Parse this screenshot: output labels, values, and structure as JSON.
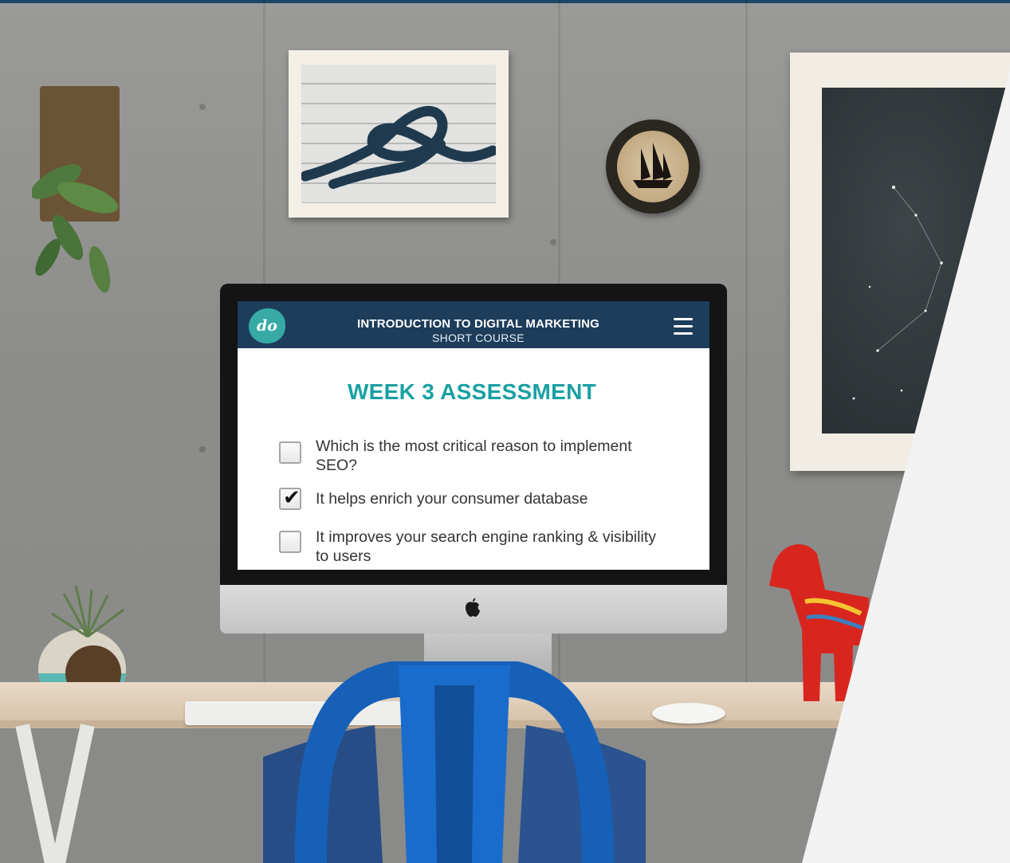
{
  "app": {
    "logo_text": "do",
    "title": "INTRODUCTION TO DIGITAL MARKETING",
    "subtitle": "SHORT COURSE",
    "menu_icon": "hamburger-menu-icon"
  },
  "assessment": {
    "heading": "WEEK 3 ASSESSMENT",
    "items": [
      {
        "text": "Which is the most critical reason to implement SEO?",
        "checked": false
      },
      {
        "text": "It helps enrich your consumer database",
        "checked": true
      },
      {
        "text": "It improves your search engine ranking & visibility to users",
        "checked": false
      }
    ]
  },
  "colors": {
    "header_bg": "#1d3d5b",
    "accent_teal": "#1aa0a3",
    "logo_bg": "#37aaa6"
  }
}
